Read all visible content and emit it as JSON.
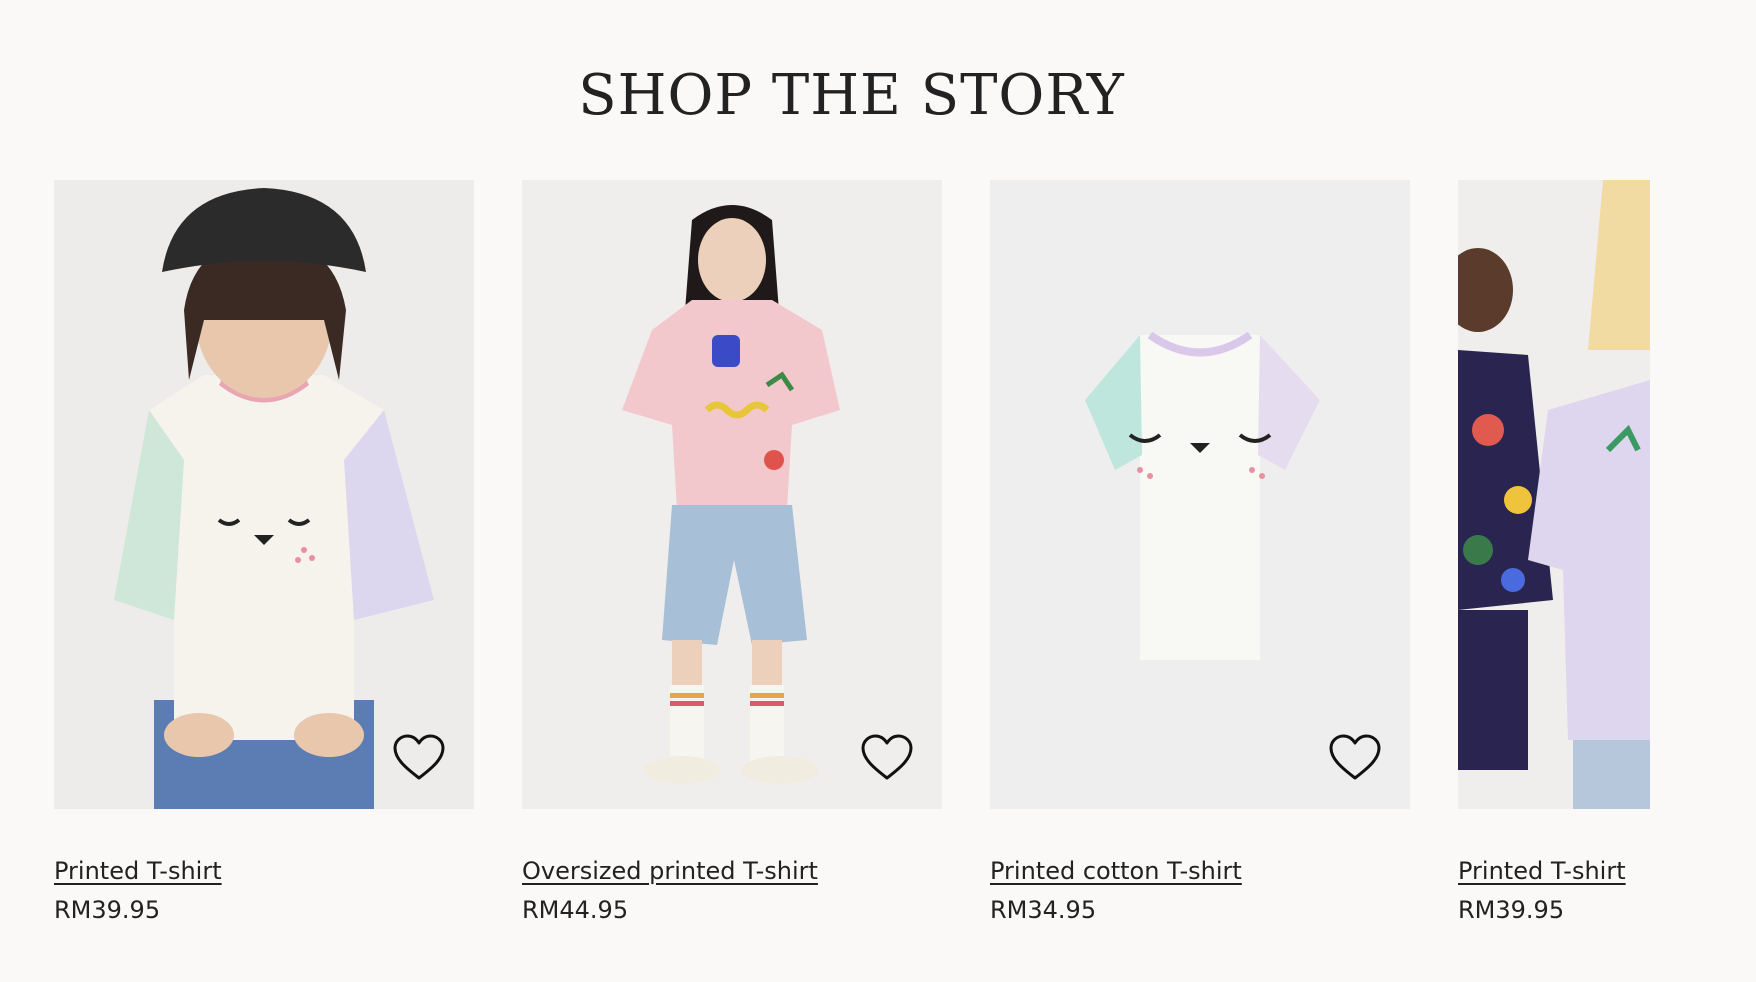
{
  "section": {
    "title": "SHOP THE STORY"
  },
  "products": [
    {
      "name": "Printed T-shirt",
      "price": "RM39.95",
      "image": "child in black cap wearing a printed face T-shirt",
      "favorite_icon": "heart-outline-icon"
    },
    {
      "name": "Oversized printed T-shirt",
      "price": "RM44.95",
      "image": "child in a pink oversized printed T-shirt and denim shorts",
      "favorite_icon": "heart-outline-icon"
    },
    {
      "name": "Printed cotton T-shirt",
      "price": "RM34.95",
      "image": "white T-shirt with sleepy face print, mint and lilac sleeves",
      "favorite_icon": "heart-outline-icon"
    },
    {
      "name": "Printed T-shirt",
      "price": "RM39.95",
      "image": "two children in colourful printed clothing (partially visible)"
    }
  ],
  "colors": {
    "page_background": "#faf9f8",
    "text": "#222222",
    "image_background": "#ecebe9"
  }
}
